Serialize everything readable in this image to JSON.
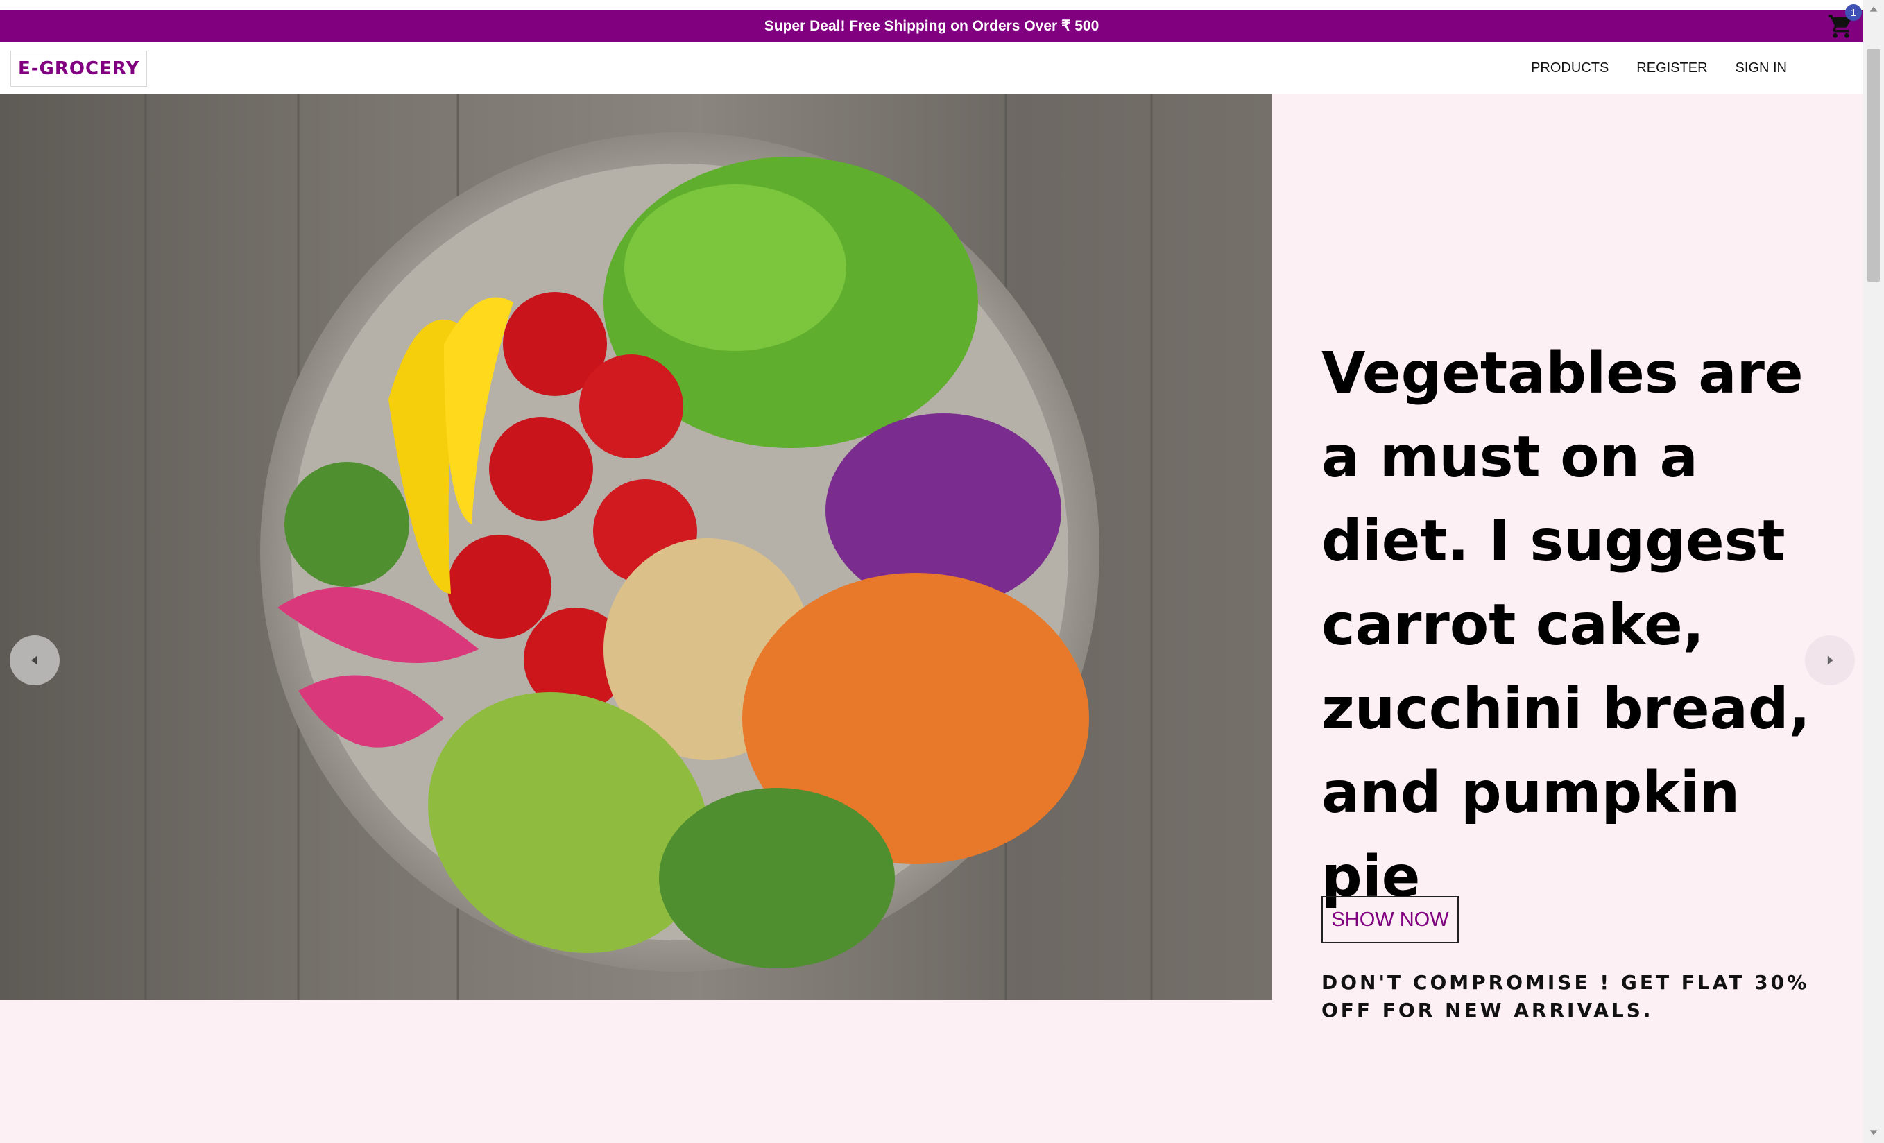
{
  "banner": {
    "text": "Super Deal! Free Shipping on Orders Over ₹ 500"
  },
  "header": {
    "logo": "E-GROCERY",
    "nav": [
      {
        "label": "PRODUCTS"
      },
      {
        "label": "REGISTER"
      },
      {
        "label": "SIGN IN"
      }
    ],
    "cart": {
      "icon": "shopping-cart-icon",
      "count": "1"
    }
  },
  "hero": {
    "image_description_icon": "salad-bowl-image",
    "headline": "Vegetables are a must on a diet. I suggest carrot cake, zucchini bread, and pumpkin pie",
    "subline": "DON'T COMPROMISE ! GET FLAT 30% OFF FOR NEW ARRIVALS.",
    "cta": "SHOW NOW",
    "prev_icon": "chevron-left-icon",
    "next_icon": "chevron-right-icon"
  },
  "colors": {
    "brand": "#800080",
    "hero_bg": "#fcf0f4",
    "badge": "#3f51b5"
  }
}
